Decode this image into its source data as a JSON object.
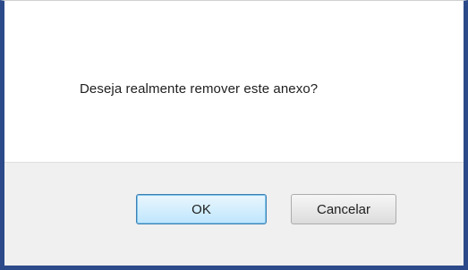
{
  "dialog": {
    "message": "Deseja realmente remover este anexo?",
    "ok_label": "OK",
    "cancel_label": "Cancelar"
  }
}
